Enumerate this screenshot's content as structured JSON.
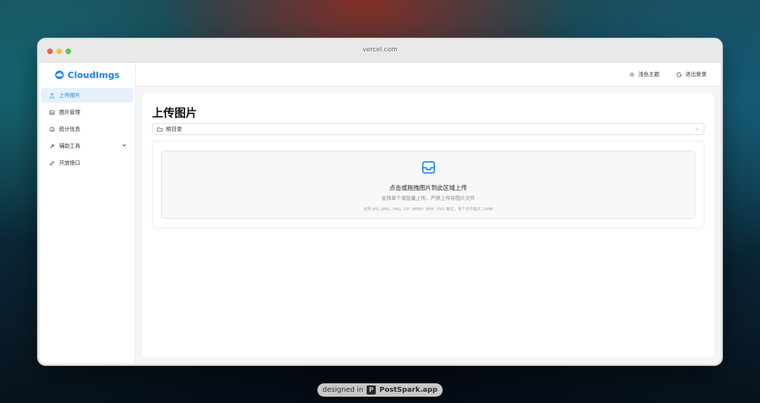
{
  "browser": {
    "url": "vercel.com"
  },
  "brand": {
    "name": "CloudImgs",
    "accent": "#2186f2"
  },
  "sidebar": {
    "items": [
      {
        "label": "上传图片",
        "icon": "upload-icon",
        "active": true
      },
      {
        "label": "图片管理",
        "icon": "image-icon",
        "active": false
      },
      {
        "label": "统计信息",
        "icon": "dashboard-icon",
        "active": false
      },
      {
        "label": "辅助工具",
        "icon": "tool-icon",
        "active": false,
        "expandable": true
      },
      {
        "label": "开放接口",
        "icon": "link-icon",
        "active": false
      }
    ]
  },
  "topbar": {
    "theme_label": "浅色主题",
    "logout_label": "退出登录"
  },
  "main": {
    "title": "上传图片",
    "folder": "根目录",
    "upload": {
      "title": "点击或拖拽图片到此区域上传",
      "subtitle": "支持单个或批量上传，严禁上传非图片文件",
      "formats": "支持 JPG, JPEG, PNG, GIF, WEBP, BMP, SVG 格式，单个文件最大 10MB"
    }
  },
  "footer_badge": {
    "prefix": "designed in",
    "name": "PostSpark.app"
  }
}
